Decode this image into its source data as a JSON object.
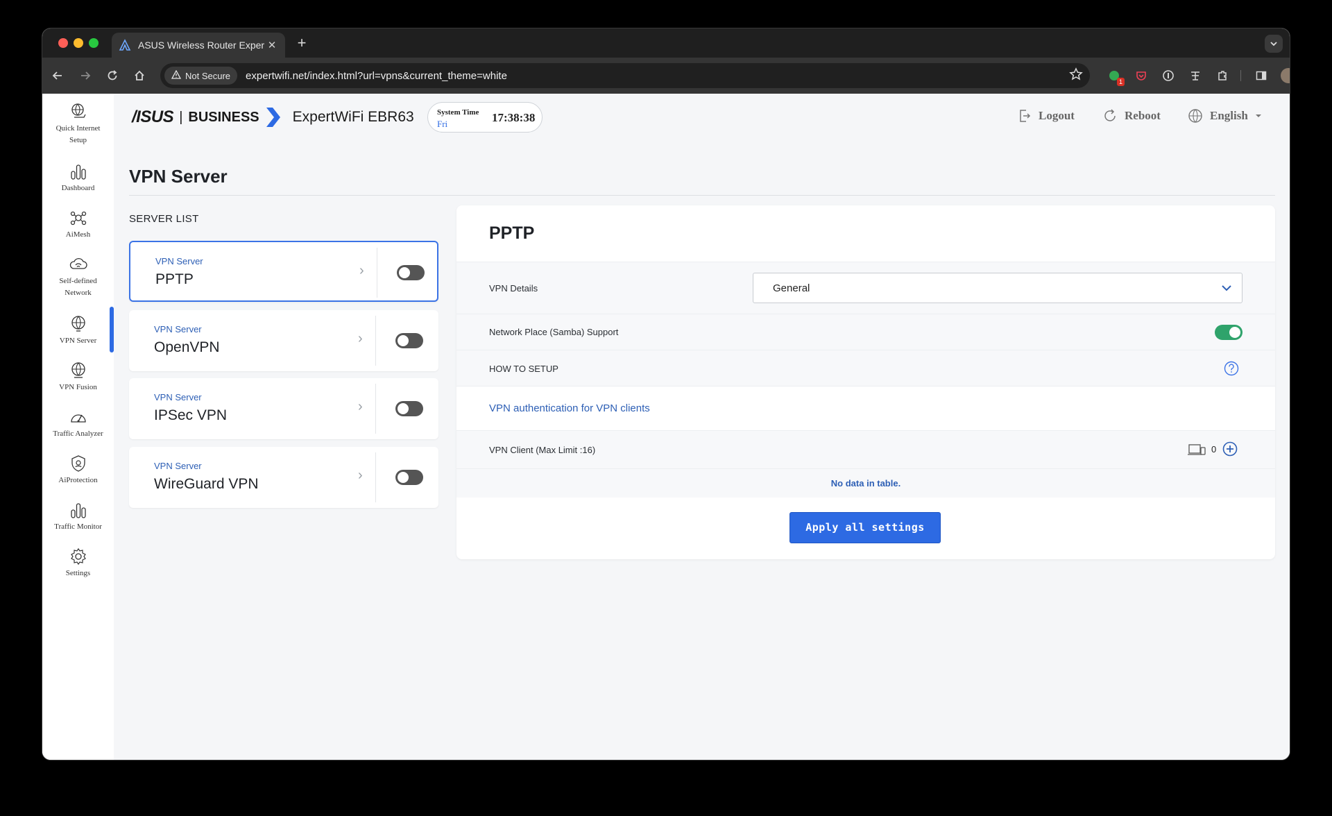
{
  "browser": {
    "tab_title": "ASUS Wireless Router Exper",
    "tab_close": "✕",
    "new_tab": "+",
    "security_label": "Not Secure",
    "url": "expertwifi.net/index.html?url=vpns&current_theme=white",
    "extension_badge": "1"
  },
  "sidebar": {
    "items": [
      {
        "line1": "Quick Internet",
        "line2": "Setup"
      },
      {
        "line1": "Dashboard",
        "line2": ""
      },
      {
        "line1": "AiMesh",
        "line2": ""
      },
      {
        "line1": "Self-defined",
        "line2": "Network"
      },
      {
        "line1": "VPN Server",
        "line2": ""
      },
      {
        "line1": "VPN Fusion",
        "line2": ""
      },
      {
        "line1": "Traffic Analyzer",
        "line2": ""
      },
      {
        "line1": "AiProtection",
        "line2": ""
      },
      {
        "line1": "Traffic Monitor",
        "line2": ""
      },
      {
        "line1": "Settings",
        "line2": ""
      }
    ],
    "active_index": 4
  },
  "header": {
    "brand_asus": "/ISUS",
    "brand_sep": "|",
    "brand_business": "BUSINESS",
    "model": "ExpertWiFi EBR63",
    "system_time_label": "System Time",
    "system_day": "Fri",
    "system_time": "17:38:38",
    "logout": "Logout",
    "reboot": "Reboot",
    "language": "English"
  },
  "main": {
    "title": "VPN Server",
    "server_list_heading": "SERVER LIST",
    "servers": [
      {
        "sub": "VPN Server",
        "name": "PPTP",
        "enabled": false,
        "selected": true
      },
      {
        "sub": "VPN Server",
        "name": "OpenVPN",
        "enabled": false,
        "selected": false
      },
      {
        "sub": "VPN Server",
        "name": "IPSec VPN",
        "enabled": false,
        "selected": false
      },
      {
        "sub": "VPN Server",
        "name": "WireGuard VPN",
        "enabled": false,
        "selected": false
      }
    ],
    "arrow_glyph": "›"
  },
  "panel": {
    "title": "PPTP",
    "vpn_details_label": "VPN Details",
    "vpn_details_value": "General",
    "samba_label": "Network Place (Samba) Support",
    "samba_enabled": true,
    "how_to_setup": "HOW TO SETUP",
    "auth_link": "VPN authentication for VPN clients",
    "client_label": "VPN Client (Max Limit :16)",
    "client_count": "0",
    "no_data": "No data in table.",
    "apply": "Apply all settings"
  },
  "colors": {
    "accent": "#2d6ae3",
    "link": "#2d5fb5",
    "toggle_on": "#2fa36b",
    "toggle_off": "#555555"
  }
}
